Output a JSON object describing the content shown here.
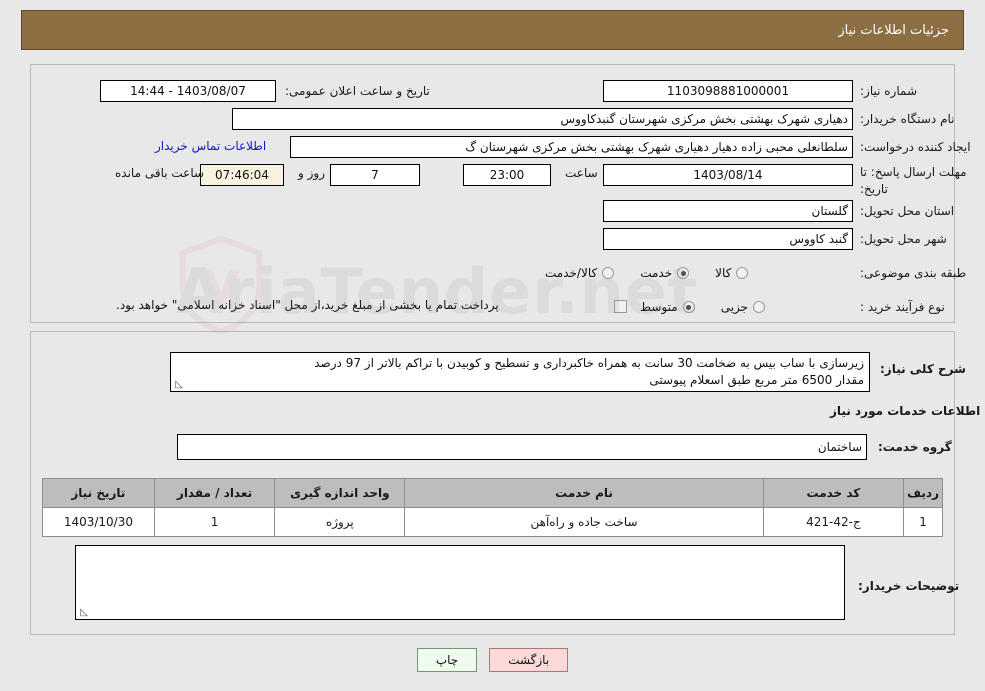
{
  "header": {
    "title": "جزئیات اطلاعات نیاز"
  },
  "watermark": {
    "text": "AriaTender.net",
    "icon": "shield-icon"
  },
  "form": {
    "need_number": {
      "label": "شماره نیاز:",
      "value": "1103098881000001"
    },
    "announce": {
      "label": "تاریخ و ساعت اعلان عمومی:",
      "value": "1403/08/07 - 14:44"
    },
    "buyer_org": {
      "label": "نام دستگاه خریدار:",
      "value": "دهیاری شهرک بهشتی بخش مرکزی شهرستان گنبدکاووس"
    },
    "requester": {
      "label": "ایجاد کننده درخواست:",
      "value": "سلطانعلی محبی زاده دهیار دهیاری شهرک بهشتی بخش مرکزی شهرستان گ"
    },
    "contact_link": "اطلاعات تماس خریدار",
    "deadline": {
      "label": "مهلت ارسال پاسخ: تا تاریخ:",
      "date": "1403/08/14",
      "hour_label": "ساعت",
      "hour": "23:00",
      "days": "7",
      "days_label": "روز و",
      "countdown": "07:46:04",
      "remaining_label": "ساعت باقی مانده"
    },
    "province": {
      "label": "استان محل تحویل:",
      "value": "گلستان"
    },
    "city": {
      "label": "شهر محل تحویل:",
      "value": "گنبد کاووس"
    },
    "category": {
      "label": "طبقه بندی موضوعی:",
      "options": [
        "کالا",
        "خدمت",
        "کالا/خدمت"
      ],
      "selected": "خدمت"
    },
    "process_type": {
      "label": "نوع فرآیند خرید :",
      "options": [
        "جزیی",
        "متوسط"
      ],
      "selected": "متوسط",
      "checkbox_label": "پرداخت تمام یا بخشی از مبلغ خرید،از محل \"اسناد خزانه اسلامی\" خواهد بود.",
      "checkbox_checked": false
    }
  },
  "description": {
    "label": "شرح کلی نیاز:",
    "line1": "زیرسازی با ساب بیس به ضخامت 30 سانت به همراه خاکبرداری و تسطیح و کوبیدن با تراکم بالاتر از 97 درصد",
    "line2": "مقدار 6500 متر مربع طبق اسعلام پیوستی"
  },
  "services_section": {
    "heading": "اطلاعات خدمات مورد نیاز",
    "group_label": "گروه خدمت:",
    "group_value": "ساختمان"
  },
  "table": {
    "columns": [
      "ردیف",
      "کد خدمت",
      "نام خدمت",
      "واحد اندازه گیری",
      "تعداد / مقدار",
      "تاریخ نیاز"
    ],
    "rows": [
      {
        "row": "1",
        "code": "ج-42-421",
        "name": "ساخت جاده و راه‌آهن",
        "unit": "پروژه",
        "qty": "1",
        "date": "1403/10/30"
      }
    ]
  },
  "buyer_notes": {
    "label": "توضیحات خریدار:",
    "value": ""
  },
  "buttons": {
    "print": "چاپ",
    "back": "بازگشت"
  },
  "colors": {
    "header_bar": "#8d6e42",
    "page_bg": "#e8e8e8",
    "link": "#1414cd",
    "table_header": "#bdbdbd",
    "print_btn": "#eefbee",
    "back_btn": "#fbd9d9",
    "countdown_field": "#f7f3e0"
  }
}
